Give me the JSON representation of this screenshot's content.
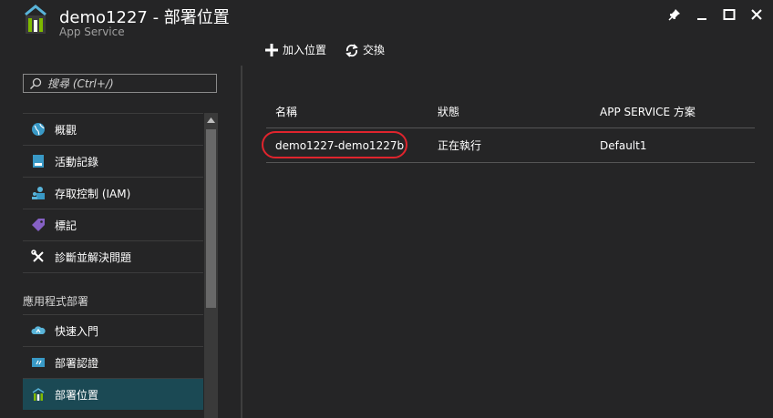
{
  "header": {
    "title": "demo1227 - 部署位置",
    "subtitle": "App Service",
    "logo_icon": "app-service-logo-icon",
    "window_controls": [
      "pin-icon",
      "minimize-icon",
      "maximize-icon",
      "close-icon"
    ]
  },
  "toolbar": {
    "add_location_label": "加入位置",
    "swap_label": "交換"
  },
  "sidebar": {
    "search_placeholder": "搜尋 (Ctrl+/)",
    "items": [
      {
        "label": "概觀",
        "icon": "globe-icon"
      },
      {
        "label": "活動記錄",
        "icon": "log-icon"
      },
      {
        "label": "存取控制 (IAM)",
        "icon": "users-icon"
      },
      {
        "label": "標記",
        "icon": "tag-icon"
      },
      {
        "label": "診斷並解決問題",
        "icon": "wrench-icon"
      }
    ],
    "section_title": "應用程式部署",
    "section_items": [
      {
        "label": "快速入門",
        "icon": "cloud-icon"
      },
      {
        "label": "部署認證",
        "icon": "credentials-icon"
      },
      {
        "label": "部署位置",
        "icon": "slots-icon",
        "active": true
      }
    ]
  },
  "table": {
    "headers": [
      "名稱",
      "狀態",
      "APP SERVICE 方案"
    ],
    "rows": [
      [
        "demo1227-demo1227b",
        "正在執行",
        "Default1"
      ]
    ]
  },
  "colors": {
    "background": "#252526",
    "active_item": "#1b4954",
    "highlight": "#e0242d"
  }
}
